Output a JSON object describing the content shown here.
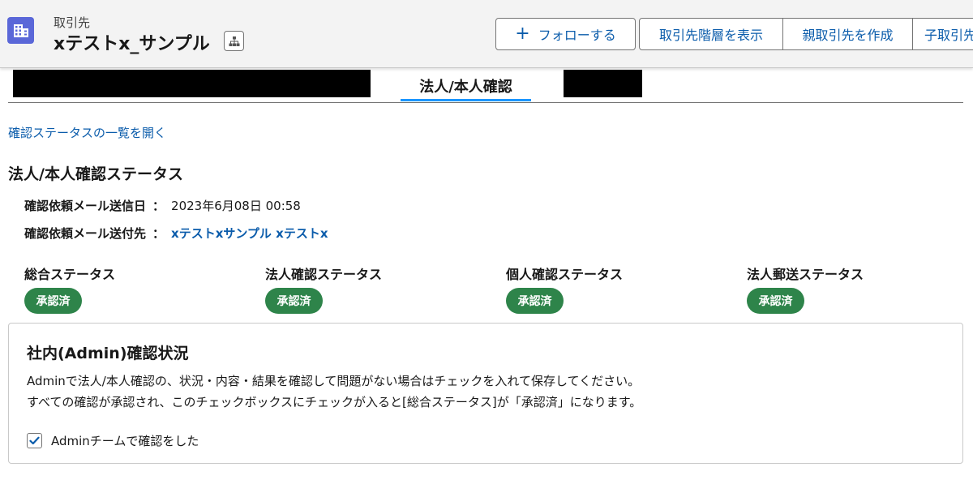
{
  "header": {
    "object_type": "取引先",
    "record_name": "xテストx_サンプル",
    "icons": {
      "object": "building-grid-icon",
      "hierarchy": "hierarchy-icon"
    },
    "brand_color": "#5a67d8",
    "follow_label": "フォローする",
    "actions": [
      "取引先階層を表示",
      "親取引先を作成",
      "子取引先"
    ]
  },
  "tabs": {
    "active_label": "法人/本人確認"
  },
  "main": {
    "open_list_link": "確認ステータスの一覧を開く",
    "section_title": "法人/本人確認ステータス",
    "fields": [
      {
        "label": "確認依頼メール送信日",
        "value": "2023年6月08日 00:58"
      },
      {
        "label": "確認依頼メール送付先",
        "value": "xテストxサンプル xテストx"
      }
    ],
    "statuses": [
      {
        "label": "総合ステータス",
        "value": "承認済"
      },
      {
        "label": "法人確認ステータス",
        "value": "承認済"
      },
      {
        "label": "個人確認ステータス",
        "value": "承認済"
      },
      {
        "label": "法人郵送ステータス",
        "value": "承認済"
      }
    ],
    "status_color": "#2e844a"
  },
  "admin_card": {
    "title": "社内(Admin)確認状況",
    "line1": "Adminで法人/本人確認の、状況・内容・結果を確認して問題がない場合はチェックを入れて保存してください。",
    "line2": "すべての確認が承認され、このチェックボックスにチェックが入ると[総合ステータス]が「承認済」になります。",
    "checkbox_label": "Adminチームで確認をした",
    "checked": true
  }
}
